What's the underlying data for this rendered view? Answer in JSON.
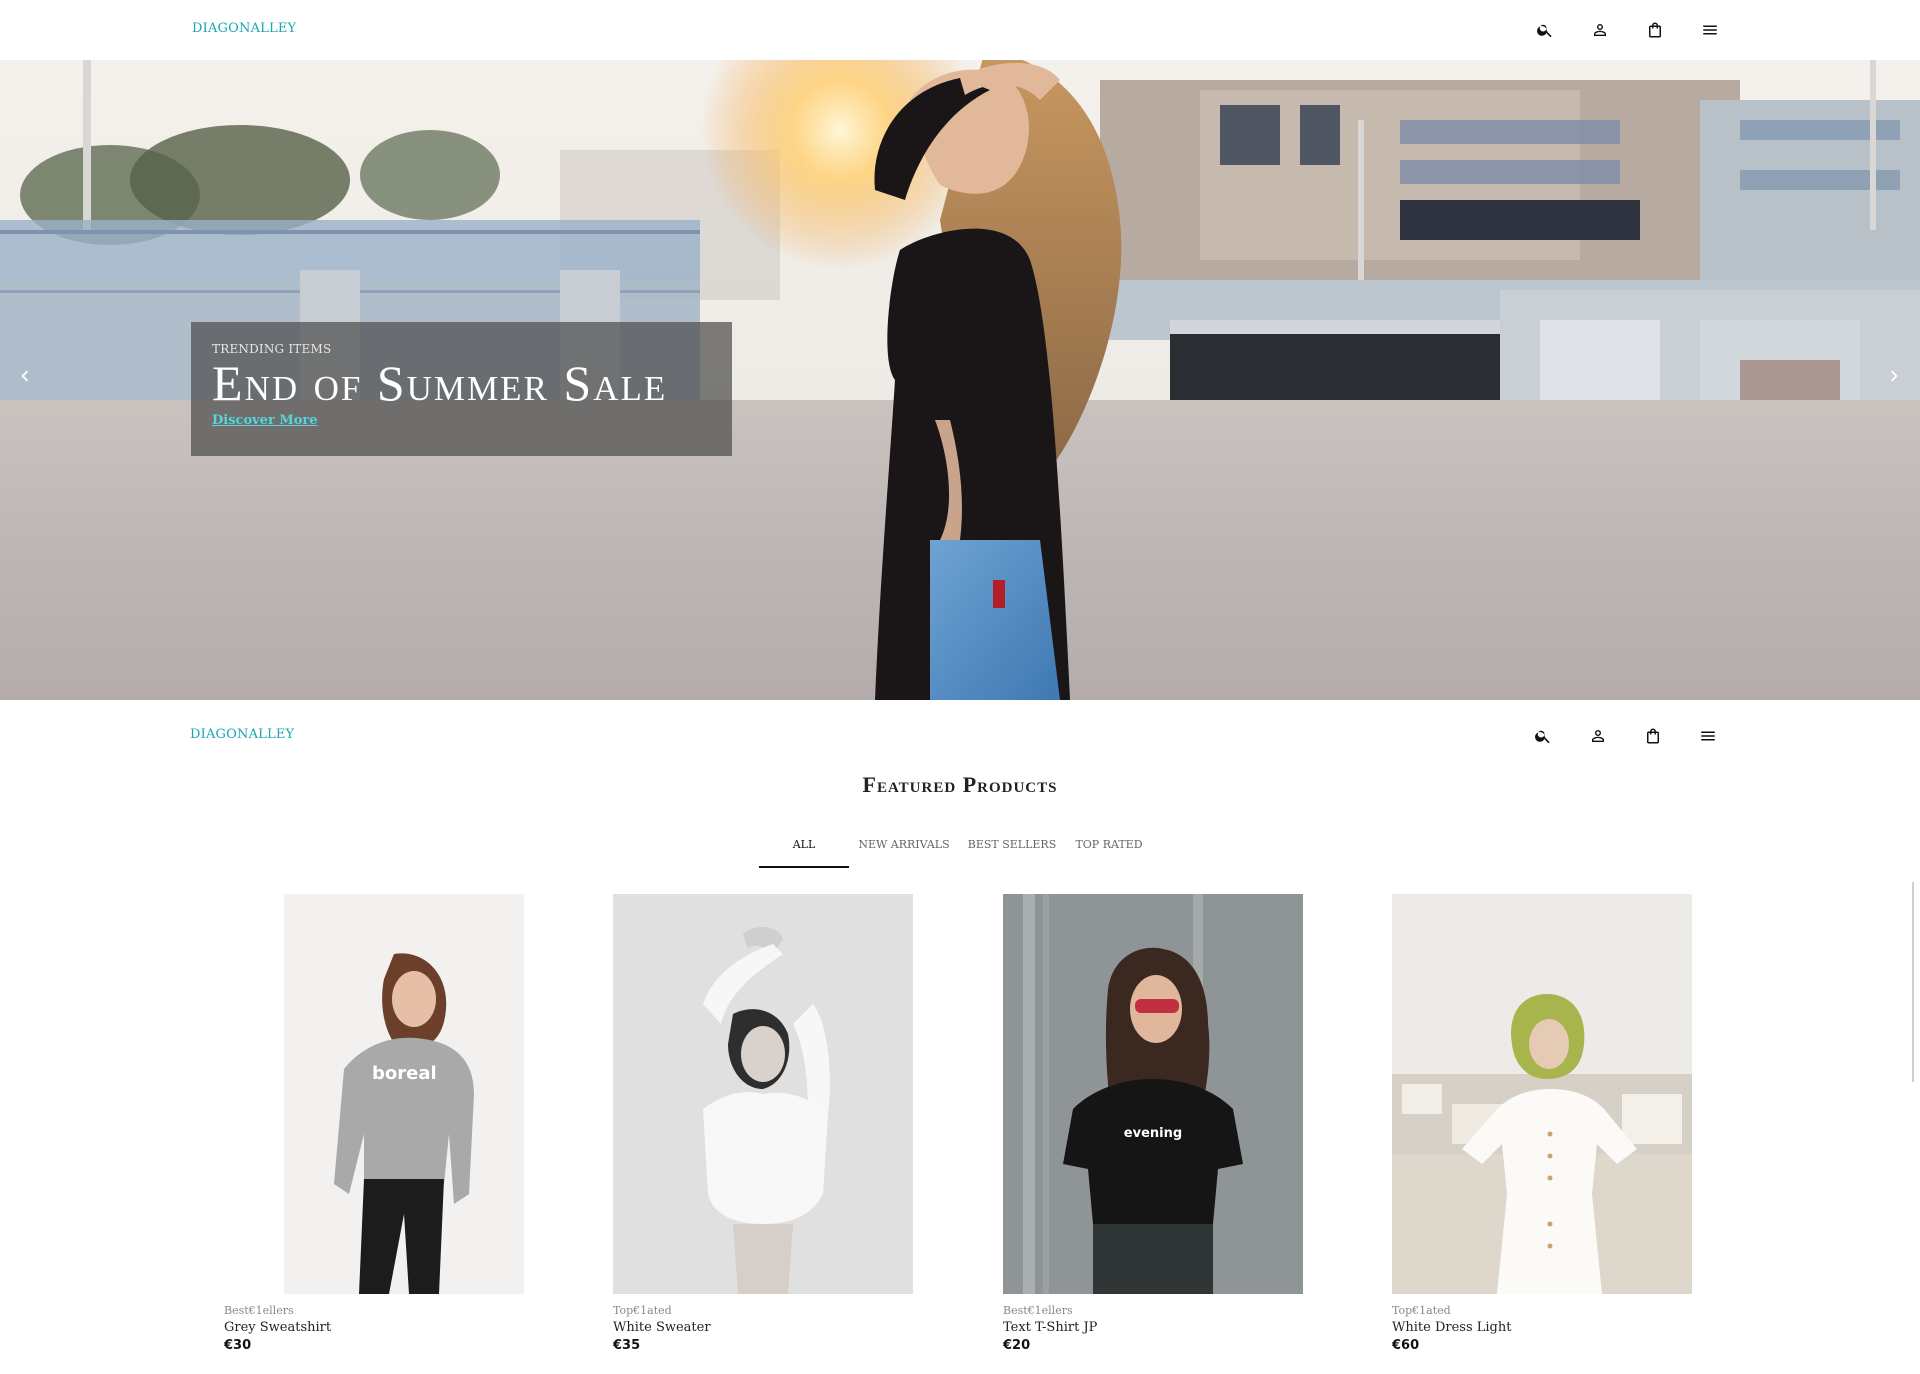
{
  "brand": "DIAGONALLEY",
  "nav_icons": [
    "search-icon",
    "account-icon",
    "shopping-bag-icon",
    "menu-icon"
  ],
  "hero": {
    "kicker": "TRENDING ITEMS",
    "title": "End of Summer Sale",
    "link": "Discover More"
  },
  "featured": {
    "title_light": "Featured",
    "title_strong": "Products",
    "tabs": [
      {
        "label": "ALL",
        "active": true
      },
      {
        "label": "NEW ARRIVALS",
        "active": false
      },
      {
        "label": "BEST SELLERS",
        "active": false
      },
      {
        "label": "TOP RATED",
        "active": false
      }
    ],
    "products": [
      {
        "category": "Best€1ellers",
        "name": "Grey Sweatshirt",
        "price": "€30"
      },
      {
        "category": "Top€1ated",
        "name": "White Sweater",
        "price": "€35"
      },
      {
        "category": "Best€1ellers",
        "name": "Text T-Shirt JP",
        "price": "€20"
      },
      {
        "category": "Top€1ated",
        "name": "White Dress Light",
        "price": "€60"
      }
    ]
  },
  "colors": {
    "brand": "#1aa5b0",
    "link_accent": "#57d4dc",
    "caption_bg": "#4e4e4e"
  }
}
